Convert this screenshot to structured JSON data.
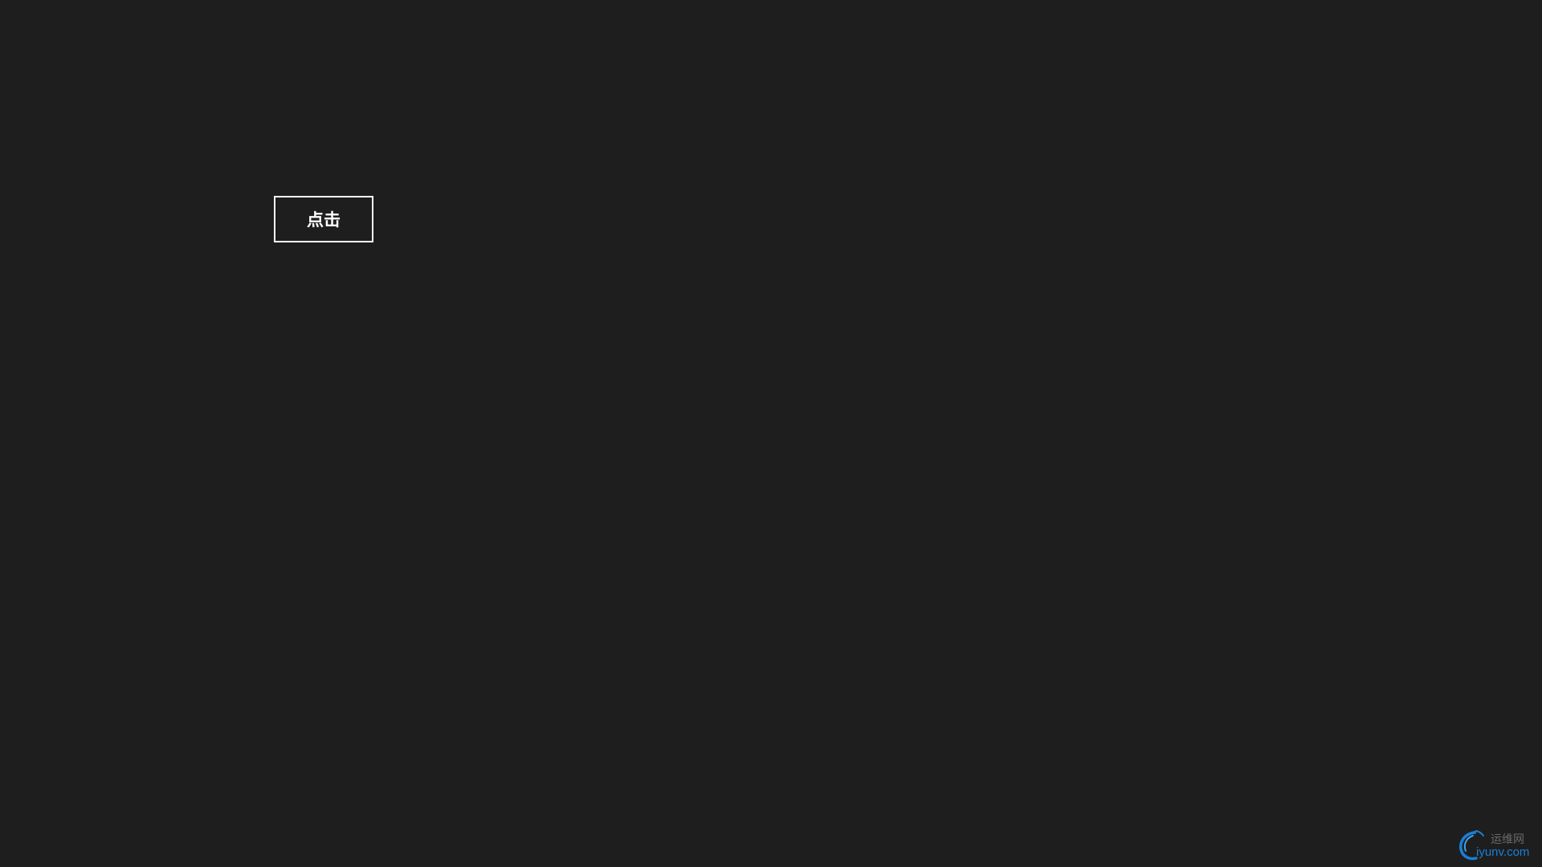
{
  "button": {
    "label": "点击"
  },
  "watermark": {
    "chinese_text": "运维网",
    "site_text": "iyunv.com",
    "icon": "swirl-logo-icon"
  },
  "colors": {
    "background": "#1e1e1e",
    "button_border": "#ffffff",
    "button_text": "#ffffff",
    "watermark_blue": "#1a7fd6",
    "watermark_gray": "#6b6b6b"
  }
}
